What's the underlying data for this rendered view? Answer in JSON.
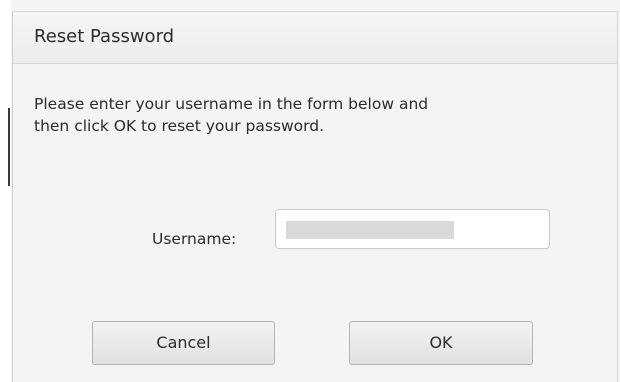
{
  "dialog": {
    "title": "Reset Password",
    "message_lines": [
      "Please enter your username in the form below and",
      "then click OK to reset your password."
    ],
    "username": {
      "label": "Username:",
      "value": ""
    },
    "buttons": {
      "cancel_label": "Cancel",
      "ok_label": "OK"
    }
  }
}
